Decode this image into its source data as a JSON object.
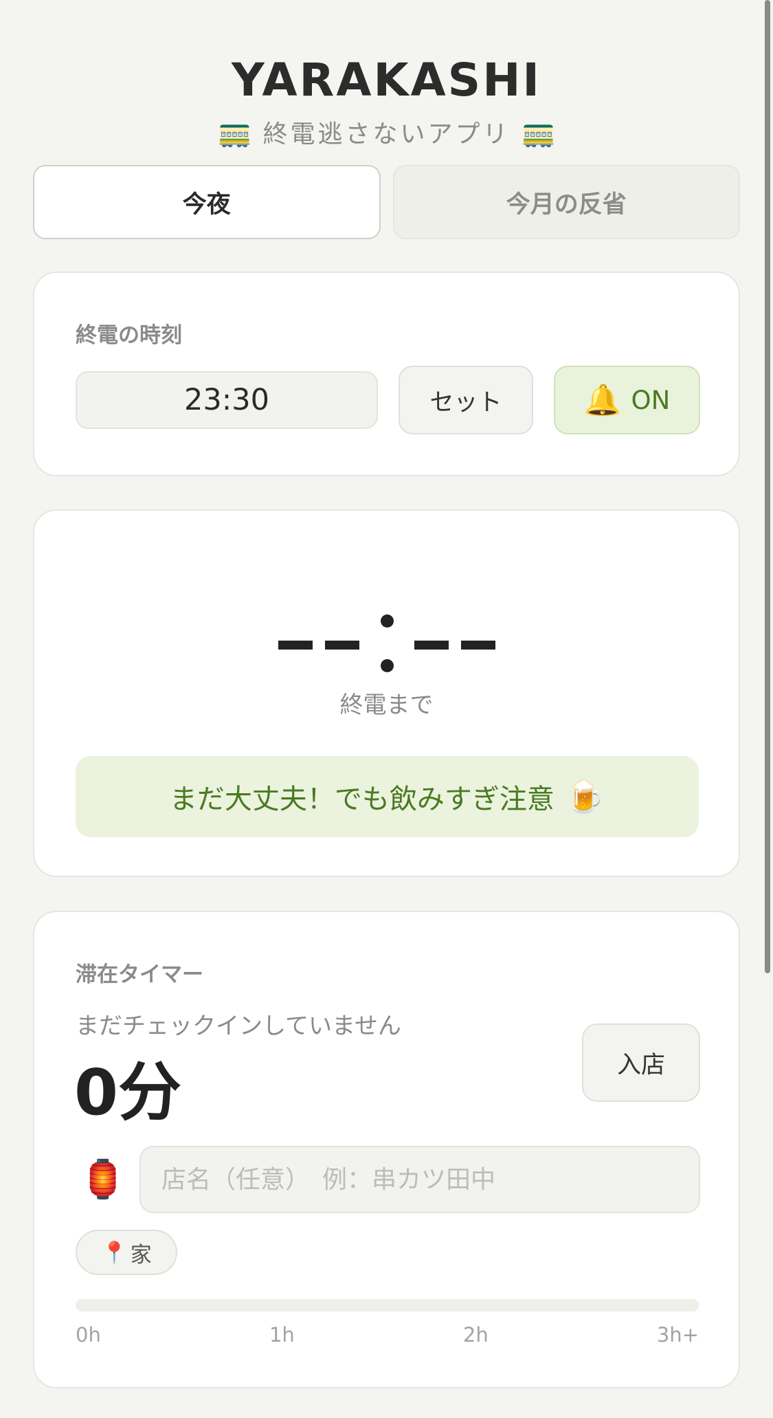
{
  "header": {
    "title": "YARAKASHI",
    "subtitle": "終電逃さないアプリ",
    "tram_glyph": "🚃"
  },
  "tabs": [
    {
      "label": "今夜",
      "active": true
    },
    {
      "label": "今月の反省",
      "active": false
    }
  ],
  "last_train": {
    "label": "終電の時刻",
    "time_value": "23:30",
    "set_label": "セット",
    "alarm_icon": "🔔",
    "alarm_label": "ON"
  },
  "countdown": {
    "until_label": "終電まで",
    "status_message": "まだ大丈夫！でも飲みすぎ注意",
    "status_icon": "🍺"
  },
  "stay_timer": {
    "label": "滞在タイマー",
    "checkin_status": "まだチェックインしていません",
    "duration": "0分",
    "enter_label": "入店",
    "lantern_icon": "🏮",
    "shop_placeholder": "店名（任意）　例：串カツ田中",
    "shop_value": "",
    "place_icon": "📍",
    "place_label": "家",
    "progress": 0,
    "ticks": [
      "0h",
      "1h",
      "2h",
      "3h+"
    ]
  },
  "colors": {
    "background": "#f4f4f0",
    "accent_green": "#4a7a22",
    "accent_green_bg": "#ebf3de"
  }
}
